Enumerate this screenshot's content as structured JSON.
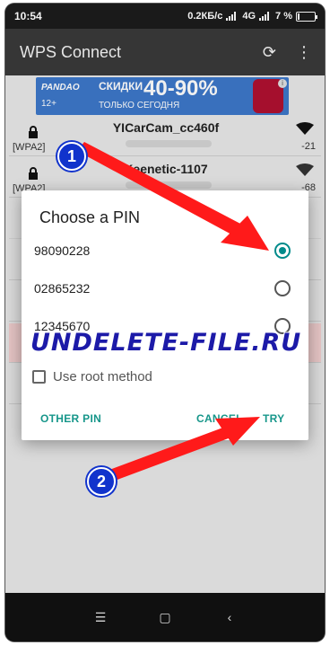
{
  "status_bar": {
    "time": "10:54",
    "speed": "0.2КБ/с",
    "network": "4G",
    "battery": "7 %"
  },
  "app_bar": {
    "title": "WPS Connect",
    "refresh_icon": "refresh-icon",
    "menu_icon": "more-vert-icon"
  },
  "ad": {
    "brand": "PANDAO",
    "rating": "12+",
    "title": "СКИДКИ",
    "percent": "40-90%",
    "subtitle": "ТОЛЬКО СЕГОДНЯ"
  },
  "networks": [
    {
      "ssid": "YICarCam_cc460f",
      "security": "[WPA2]",
      "rssi": "-21"
    },
    {
      "ssid": "Keenetic-1107",
      "security": "[WPA2]",
      "rssi": "-68"
    }
  ],
  "dialog": {
    "title": "Choose a PIN",
    "pins": [
      {
        "label": "98090228",
        "selected": true
      },
      {
        "label": "02865232",
        "selected": false
      },
      {
        "label": "12345670",
        "selected": false
      }
    ],
    "root_label": "Use root method",
    "root_checked": false,
    "other_pin": "OTHER PIN",
    "cancel": "CANCEL",
    "try": "TRY"
  },
  "watermark": "UNDELETE-FILE.RU",
  "annotations": {
    "badge_1": "1",
    "badge_2": "2",
    "arrow_color": "#ff1a1a"
  },
  "nav_bar": {
    "menu_icon": "menu-icon",
    "home_icon": "home-square-icon",
    "back_icon": "back-chevron-icon"
  },
  "colors": {
    "accent": "#16968a",
    "radio": "#008b8b",
    "appbar": "#363636",
    "watermark": "#1c1aa8"
  }
}
